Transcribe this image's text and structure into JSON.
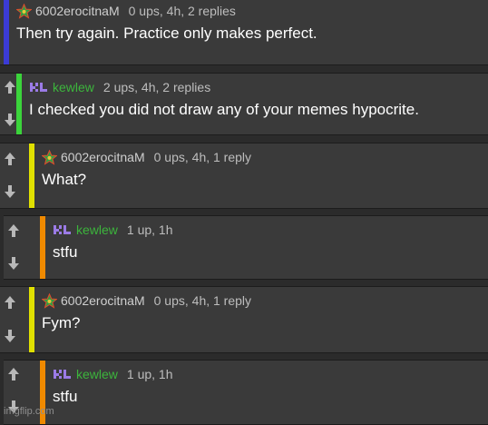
{
  "comments": [
    {
      "user": "6002erocitnaM",
      "avatar": "star-avatar-icon",
      "meta": "0 ups, 4h, 2 replies",
      "text": "Then try again. Practice only makes perfect.",
      "bar_color": "#3b3bd6",
      "user_color": "#cfcfcf"
    },
    {
      "user": "kewlew",
      "avatar": "kl-avatar-icon",
      "meta": "2 ups, 4h, 2 replies",
      "text": "I checked you did not draw any of your memes hypocrite.",
      "bar_color": "#3bd43b",
      "user_color": "#3cb53c"
    },
    {
      "user": "6002erocitnaM",
      "avatar": "star-avatar-icon",
      "meta": "0 ups, 4h, 1 reply",
      "text": "What?",
      "bar_color": "#e0e000",
      "user_color": "#cfcfcf"
    },
    {
      "user": "kewlew",
      "avatar": "kl-avatar-icon",
      "meta": "1 up, 1h",
      "text": "stfu",
      "bar_color": "#f08a00",
      "user_color": "#3cb53c"
    },
    {
      "user": "6002erocitnaM",
      "avatar": "star-avatar-icon",
      "meta": "0 ups, 4h, 1 reply",
      "text": "Fym?",
      "bar_color": "#e0e000",
      "user_color": "#cfcfcf"
    },
    {
      "user": "kewlew",
      "avatar": "kl-avatar-icon",
      "meta": "1 up, 1h",
      "text": "stfu",
      "bar_color": "#f08a00",
      "user_color": "#3cb53c"
    }
  ],
  "watermark": "imgflip.com"
}
